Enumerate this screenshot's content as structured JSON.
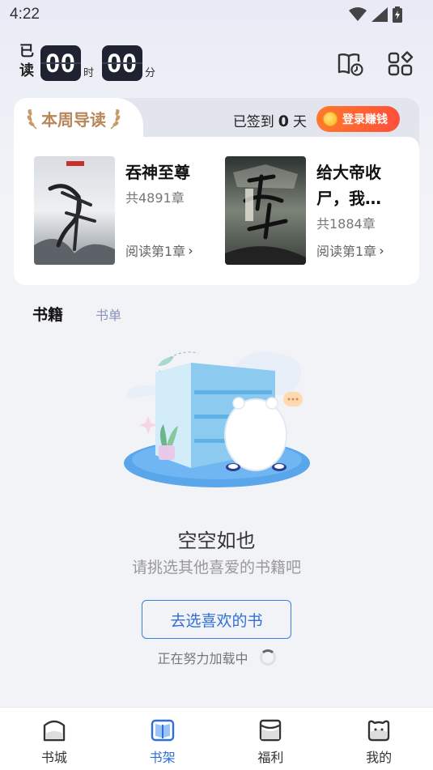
{
  "status_bar": {
    "time": "4:22"
  },
  "reading_timer": {
    "label_line1": "已",
    "label_line2": "读",
    "hours": "00",
    "hours_unit": "时",
    "minutes": "00",
    "minutes_unit": "分"
  },
  "top_icons": [
    "reading-history-icon",
    "grid-apps-icon"
  ],
  "guide": {
    "title": "本周导读",
    "checkin_prefix": "已签到",
    "checkin_days": "0",
    "checkin_suffix": "天",
    "earn_label": "登录赚钱",
    "books": [
      {
        "title": "吞神至尊",
        "chapters": "共4891章",
        "read_label": "阅读第1章"
      },
      {
        "title": "给大帝收尸，我…",
        "chapters": "共1884章",
        "read_label": "阅读第1章"
      }
    ]
  },
  "tabs": {
    "books": "书籍",
    "lists": "书单"
  },
  "empty": {
    "title": "空空如也",
    "subtitle": "请挑选其他喜爱的书籍吧",
    "button": "去选喜欢的书",
    "loading": "正在努力加载中"
  },
  "bottom_nav": [
    {
      "label": "书城",
      "icon": "bookstore-icon",
      "active": false
    },
    {
      "label": "书架",
      "icon": "bookshelf-icon",
      "active": true
    },
    {
      "label": "福利",
      "icon": "welfare-icon",
      "active": false
    },
    {
      "label": "我的",
      "icon": "profile-icon",
      "active": false
    }
  ],
  "colors": {
    "accent": "#2f6fd6",
    "earn_gradient_start": "#ff7a2a",
    "earn_gradient_end": "#ff4f3b",
    "guide_gold": "#b7865a"
  }
}
